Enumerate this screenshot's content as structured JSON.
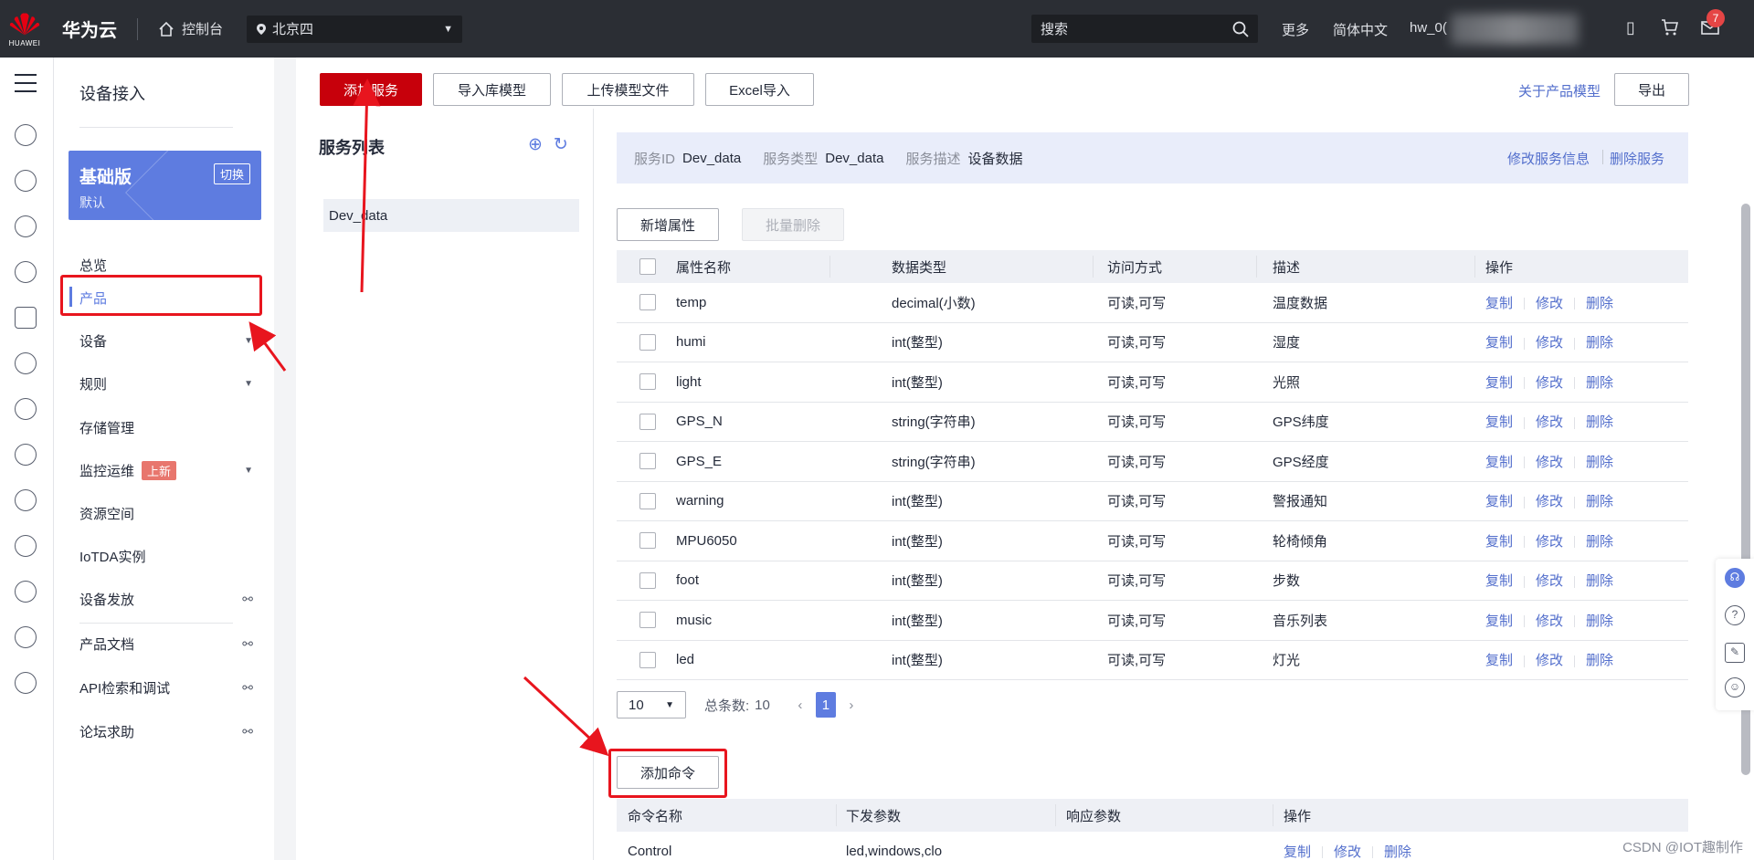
{
  "topbar": {
    "brand": "HUAWEI",
    "cloud_name": "华为云",
    "console": "控制台",
    "region": "北京四",
    "search_placeholder": "搜索",
    "more": "更多",
    "language": "简体中文",
    "user": "hw_0(",
    "mail_count": "7"
  },
  "nav": {
    "title": "设备接入",
    "edition": {
      "name": "基础版",
      "sub": "默认",
      "switch": "切换"
    },
    "items": [
      {
        "label": "总览"
      },
      {
        "label": "产品"
      },
      {
        "label": "设备"
      },
      {
        "label": "规则"
      },
      {
        "label": "存储管理"
      },
      {
        "label": "监控运维",
        "tag": "上新"
      },
      {
        "label": "资源空间"
      },
      {
        "label": "IoTDA实例"
      },
      {
        "label": "设备发放"
      },
      {
        "label": "产品文档"
      },
      {
        "label": "API检索和调试"
      },
      {
        "label": "论坛求助"
      }
    ]
  },
  "toolbar": {
    "add_service": "添加服务",
    "import_model": "导入库模型",
    "upload_model": "上传模型文件",
    "excel_import": "Excel导入",
    "about_model": "关于产品模型",
    "export": "导出"
  },
  "services": {
    "title": "服务列表",
    "items": [
      "Dev_data"
    ]
  },
  "service_info": {
    "id_label": "服务ID",
    "id_value": "Dev_data",
    "type_label": "服务类型",
    "type_value": "Dev_data",
    "desc_label": "服务描述",
    "desc_value": "设备数据",
    "modify": "修改服务信息",
    "delete": "删除服务"
  },
  "properties": {
    "add_button": "新增属性",
    "batch_delete": "批量删除",
    "columns": [
      "属性名称",
      "数据类型",
      "访问方式",
      "描述",
      "操作"
    ],
    "rows": [
      {
        "name": "temp",
        "type": "decimal(小数)",
        "access": "可读,可写",
        "desc": "温度数据"
      },
      {
        "name": "humi",
        "type": "int(整型)",
        "access": "可读,可写",
        "desc": "湿度"
      },
      {
        "name": "light",
        "type": "int(整型)",
        "access": "可读,可写",
        "desc": "光照"
      },
      {
        "name": "GPS_N",
        "type": "string(字符串)",
        "access": "可读,可写",
        "desc": "GPS纬度"
      },
      {
        "name": "GPS_E",
        "type": "string(字符串)",
        "access": "可读,可写",
        "desc": "GPS经度"
      },
      {
        "name": "warning",
        "type": "int(整型)",
        "access": "可读,可写",
        "desc": "警报通知"
      },
      {
        "name": "MPU6050",
        "type": "int(整型)",
        "access": "可读,可写",
        "desc": "轮椅倾角"
      },
      {
        "name": "foot",
        "type": "int(整型)",
        "access": "可读,可写",
        "desc": "步数"
      },
      {
        "name": "music",
        "type": "int(整型)",
        "access": "可读,可写",
        "desc": "音乐列表"
      },
      {
        "name": "led",
        "type": "int(整型)",
        "access": "可读,可写",
        "desc": "灯光"
      }
    ],
    "ops": {
      "copy": "复制",
      "modify": "修改",
      "delete": "删除"
    }
  },
  "pager": {
    "page_size": "10",
    "total_label": "总条数:",
    "total": "10",
    "current": "1"
  },
  "commands": {
    "add_button": "添加命令",
    "columns": [
      "命令名称",
      "下发参数",
      "响应参数",
      "操作"
    ],
    "rows": [
      {
        "name": "Control",
        "params": "led,windows,clo",
        "response": ""
      }
    ],
    "ops": {
      "copy": "复制",
      "modify": "修改",
      "delete": "删除"
    }
  },
  "watermark": "CSDN @IOT趣制作",
  "colors": {
    "primary": "#c7000b",
    "accent": "#5e7ce0",
    "link": "#526ecc",
    "annotation": "#e8151e"
  }
}
